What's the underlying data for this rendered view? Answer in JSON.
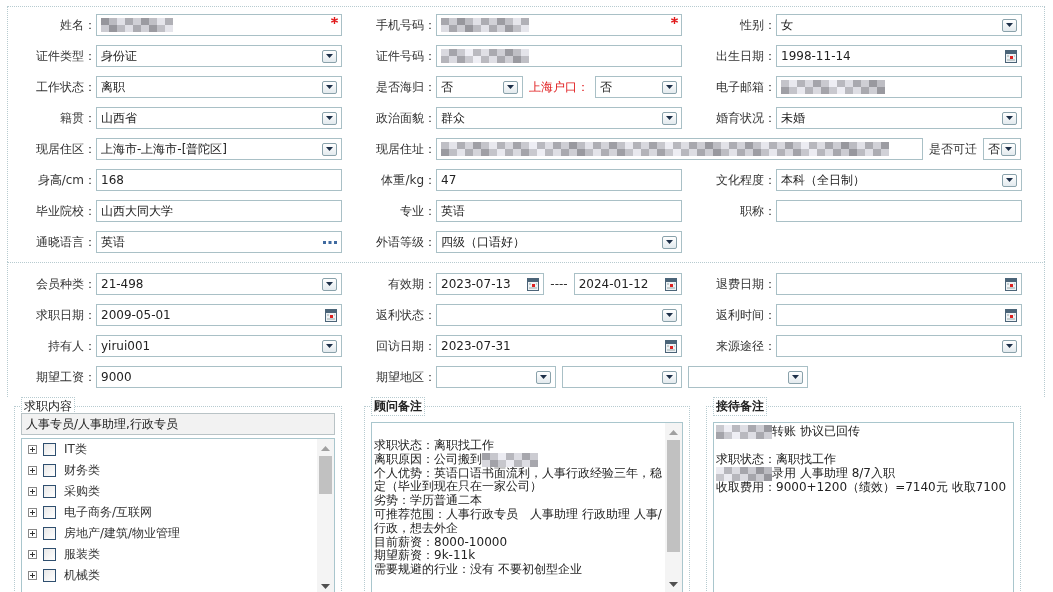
{
  "basic_info": {
    "rows": [
      [
        {
          "label": "姓名：",
          "controls": [
            {
              "kind": "text",
              "blurred": true,
              "required": true
            }
          ]
        },
        {
          "label": "手机号码：",
          "controls": [
            {
              "kind": "text",
              "blurred": true,
              "required": true
            }
          ]
        },
        {
          "label": "性别：",
          "controls": [
            {
              "kind": "select",
              "value": "女"
            }
          ]
        }
      ],
      [
        {
          "label": "证件类型：",
          "controls": [
            {
              "kind": "select",
              "value": "身份证"
            }
          ]
        },
        {
          "label": "证件号码：",
          "controls": [
            {
              "kind": "text",
              "blurred": true
            }
          ]
        },
        {
          "label": "出生日期：",
          "controls": [
            {
              "kind": "date",
              "value": "1998-11-14"
            }
          ]
        }
      ],
      [
        {
          "label": "工作状态：",
          "controls": [
            {
              "kind": "select",
              "value": "离职"
            }
          ]
        },
        {
          "label": "是否海归：",
          "controls": [
            {
              "kind": "select",
              "value": "否"
            },
            {
              "kind": "label",
              "text": "上海户口：",
              "emphasized": true
            },
            {
              "kind": "select",
              "value": "否"
            }
          ]
        },
        {
          "label": "电子邮箱：",
          "controls": [
            {
              "kind": "text",
              "blurred": true
            }
          ]
        }
      ],
      [
        {
          "label": "籍贯：",
          "controls": [
            {
              "kind": "select",
              "value": "山西省"
            }
          ]
        },
        {
          "label": "政治面貌：",
          "controls": [
            {
              "kind": "select",
              "value": "群众"
            }
          ]
        },
        {
          "label": "婚育状况：",
          "controls": [
            {
              "kind": "select",
              "value": "未婚"
            }
          ]
        }
      ],
      [
        {
          "label": "现居住区：",
          "controls": [
            {
              "kind": "select",
              "value": "上海市-上海市-[普陀区]"
            }
          ]
        },
        {
          "label": "现居住址：",
          "controls": [
            {
              "kind": "address",
              "blurred": true
            },
            {
              "kind": "label",
              "text": "是否可迁",
              "emphasized": false
            },
            {
              "kind": "select",
              "value": "否"
            }
          ]
        }
      ],
      [
        {
          "label": "身高/cm：",
          "controls": [
            {
              "kind": "text",
              "value": "168"
            }
          ]
        },
        {
          "label": "体重/kg：",
          "controls": [
            {
              "kind": "text",
              "value": "47"
            }
          ]
        },
        {
          "label": "文化程度：",
          "controls": [
            {
              "kind": "select",
              "value": "本科（全日制）"
            }
          ]
        }
      ],
      [
        {
          "label": "毕业院校：",
          "controls": [
            {
              "kind": "text",
              "value": "山西大同大学"
            }
          ]
        },
        {
          "label": "专业：",
          "controls": [
            {
              "kind": "text",
              "value": "英语"
            }
          ]
        },
        {
          "label": "职称：",
          "controls": [
            {
              "kind": "text"
            }
          ]
        }
      ],
      [
        {
          "label": "通晓语言：",
          "controls": [
            {
              "kind": "lookup",
              "value": "英语"
            }
          ]
        },
        {
          "label": "外语等级：",
          "controls": [
            {
              "kind": "select",
              "value": "四级（口语好）"
            }
          ]
        }
      ]
    ]
  },
  "membership": {
    "rows": [
      [
        {
          "label": "会员种类：",
          "controls": [
            {
              "kind": "select",
              "value": "21-498"
            }
          ]
        },
        {
          "label": "有效期：",
          "controls": [
            {
              "kind": "date",
              "value": "2023-07-13"
            },
            {
              "kind": "separator",
              "text": "----"
            },
            {
              "kind": "date",
              "value": "2024-01-12"
            }
          ]
        },
        {
          "label": "退费日期：",
          "controls": [
            {
              "kind": "date"
            }
          ]
        }
      ],
      [
        {
          "label": "求职日期：",
          "controls": [
            {
              "kind": "date",
              "value": "2009-05-01"
            }
          ]
        },
        {
          "label": "返利状态：",
          "controls": [
            {
              "kind": "select"
            }
          ]
        },
        {
          "label": "返利时间：",
          "controls": [
            {
              "kind": "date"
            }
          ]
        }
      ],
      [
        {
          "label": "持有人：",
          "controls": [
            {
              "kind": "select",
              "value": "yirui001"
            }
          ]
        },
        {
          "label": "回访日期：",
          "controls": [
            {
              "kind": "date",
              "value": "2023-07-31"
            }
          ]
        },
        {
          "label": "来源途径：",
          "controls": [
            {
              "kind": "select"
            }
          ]
        }
      ],
      [
        {
          "label": "期望工资：",
          "controls": [
            {
              "kind": "text",
              "value": "9000"
            }
          ]
        },
        {
          "label": "期望地区：",
          "controls": [
            {
              "kind": "region_select"
            },
            {
              "kind": "region_select"
            },
            {
              "kind": "region_select"
            }
          ]
        }
      ]
    ]
  },
  "job_intent": {
    "title": "求职内容",
    "summary": "人事专员/人事助理,行政专员",
    "categories": [
      {
        "label": "IT类",
        "checked": false,
        "expanded": false
      },
      {
        "label": "财务类",
        "checked": false,
        "expanded": false
      },
      {
        "label": "采购类",
        "checked": false,
        "expanded": false
      },
      {
        "label": "电子商务/互联网",
        "checked": false,
        "expanded": false
      },
      {
        "label": "房地产/建筑/物业管理",
        "checked": false,
        "expanded": false
      },
      {
        "label": "服装类",
        "checked": false,
        "expanded": false
      },
      {
        "label": "机械类",
        "checked": false,
        "expanded": false
      }
    ]
  },
  "consultant_notes": {
    "title": "顾问备注",
    "lines": [
      {
        "text": "求职状态：离职找工作",
        "space_before": true
      },
      {
        "text": "离职原因：公司搬到",
        "blur_after": true
      },
      {
        "text": "个人优势：英语口语书面流利，人事行政经验三年，稳定（毕业到现在只在一家公司）"
      },
      {
        "text": "劣势：学历普通二本"
      },
      {
        "text": "可推荐范围：人事行政专员　人事助理 行政助理 人事/行政，想去外企"
      },
      {
        "text": "目前薪资：8000-10000"
      },
      {
        "text": "期望薪资：9k-11k"
      },
      {
        "text": "需要规避的行业：没有 不要初创型企业"
      }
    ]
  },
  "reception_notes": {
    "title": "接待备注",
    "lines": [
      {
        "text": "转账 协议已回传",
        "blur_before": true
      },
      {
        "text": "求职状态：离职找工作",
        "space_before": true
      },
      {
        "text": "录用 人事助理 8/7入职",
        "blur_before": true
      },
      {
        "text": "收取费用：9000+1200（绩效）=7140元 收取7100"
      }
    ]
  }
}
